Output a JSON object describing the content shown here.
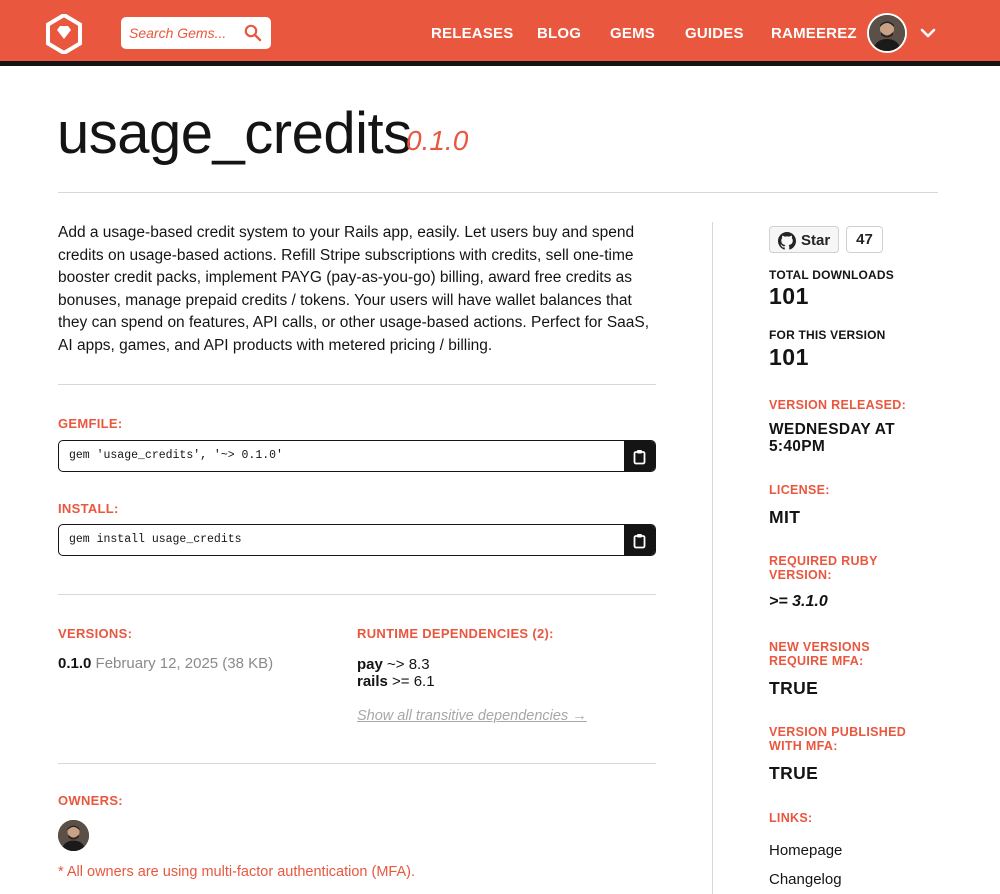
{
  "header": {
    "search_placeholder": "Search Gems...",
    "nav": [
      "RELEASES",
      "BLOG",
      "GEMS",
      "GUIDES",
      "RAMEEREZ"
    ]
  },
  "gem": {
    "name": "usage_credits",
    "version": "0.1.0",
    "description": "Add a usage-based credit system to your Rails app, easily. Let users buy and spend credits on usage-based actions. Refill Stripe subscriptions with credits, sell one-time booster credit packs, implement PAYG (pay-as-you-go) billing, award free credits as bonuses, manage prepaid credits / tokens. Your users will have wallet balances that they can spend on features, API calls, or other usage-based actions. Perfect for SaaS, AI apps, games, and API products with metered pricing / billing."
  },
  "gemfile": {
    "label": "GEMFILE:",
    "code": "gem 'usage_credits', '~> 0.1.0'"
  },
  "install": {
    "label": "INSTALL:",
    "code": "gem install usage_credits"
  },
  "versions": {
    "label": "VERSIONS:",
    "items": [
      {
        "number": "0.1.0",
        "date": "February 12, 2025",
        "size": "(38 KB)"
      }
    ]
  },
  "dependencies": {
    "label": "RUNTIME DEPENDENCIES (2):",
    "items": [
      {
        "name": "pay",
        "req": "~> 8.3"
      },
      {
        "name": "rails",
        "req": ">= 6.1"
      }
    ],
    "show_all": "Show all transitive dependencies →"
  },
  "owners": {
    "label": "OWNERS:",
    "mfa_note": "* All owners are using multi-factor authentication (MFA)."
  },
  "sidebar": {
    "star_label": "Star",
    "star_count": "47",
    "total_downloads_label": "TOTAL DOWNLOADS",
    "total_downloads": "101",
    "this_version_label": "FOR THIS VERSION",
    "this_version": "101",
    "released_label": "VERSION RELEASED:",
    "released_line1": "WEDNESDAY AT",
    "released_line2": "5:40PM",
    "license_label": "LICENSE:",
    "license": "MIT",
    "ruby_label_1": "REQUIRED RUBY",
    "ruby_label_2": "VERSION:",
    "ruby": ">= 3.1.0",
    "mfa_required_label_1": "NEW VERSIONS",
    "mfa_required_label_2": "REQUIRE MFA:",
    "mfa_required": "TRUE",
    "mfa_published_label_1": "VERSION PUBLISHED",
    "mfa_published_label_2": "WITH MFA:",
    "mfa_published": "TRUE",
    "links_label": "LINKS:",
    "links": [
      "Homepage",
      "Changelog"
    ]
  },
  "colors": {
    "brand": "#e9573f",
    "dark": "#141414",
    "muted": "#8a8a8a"
  }
}
